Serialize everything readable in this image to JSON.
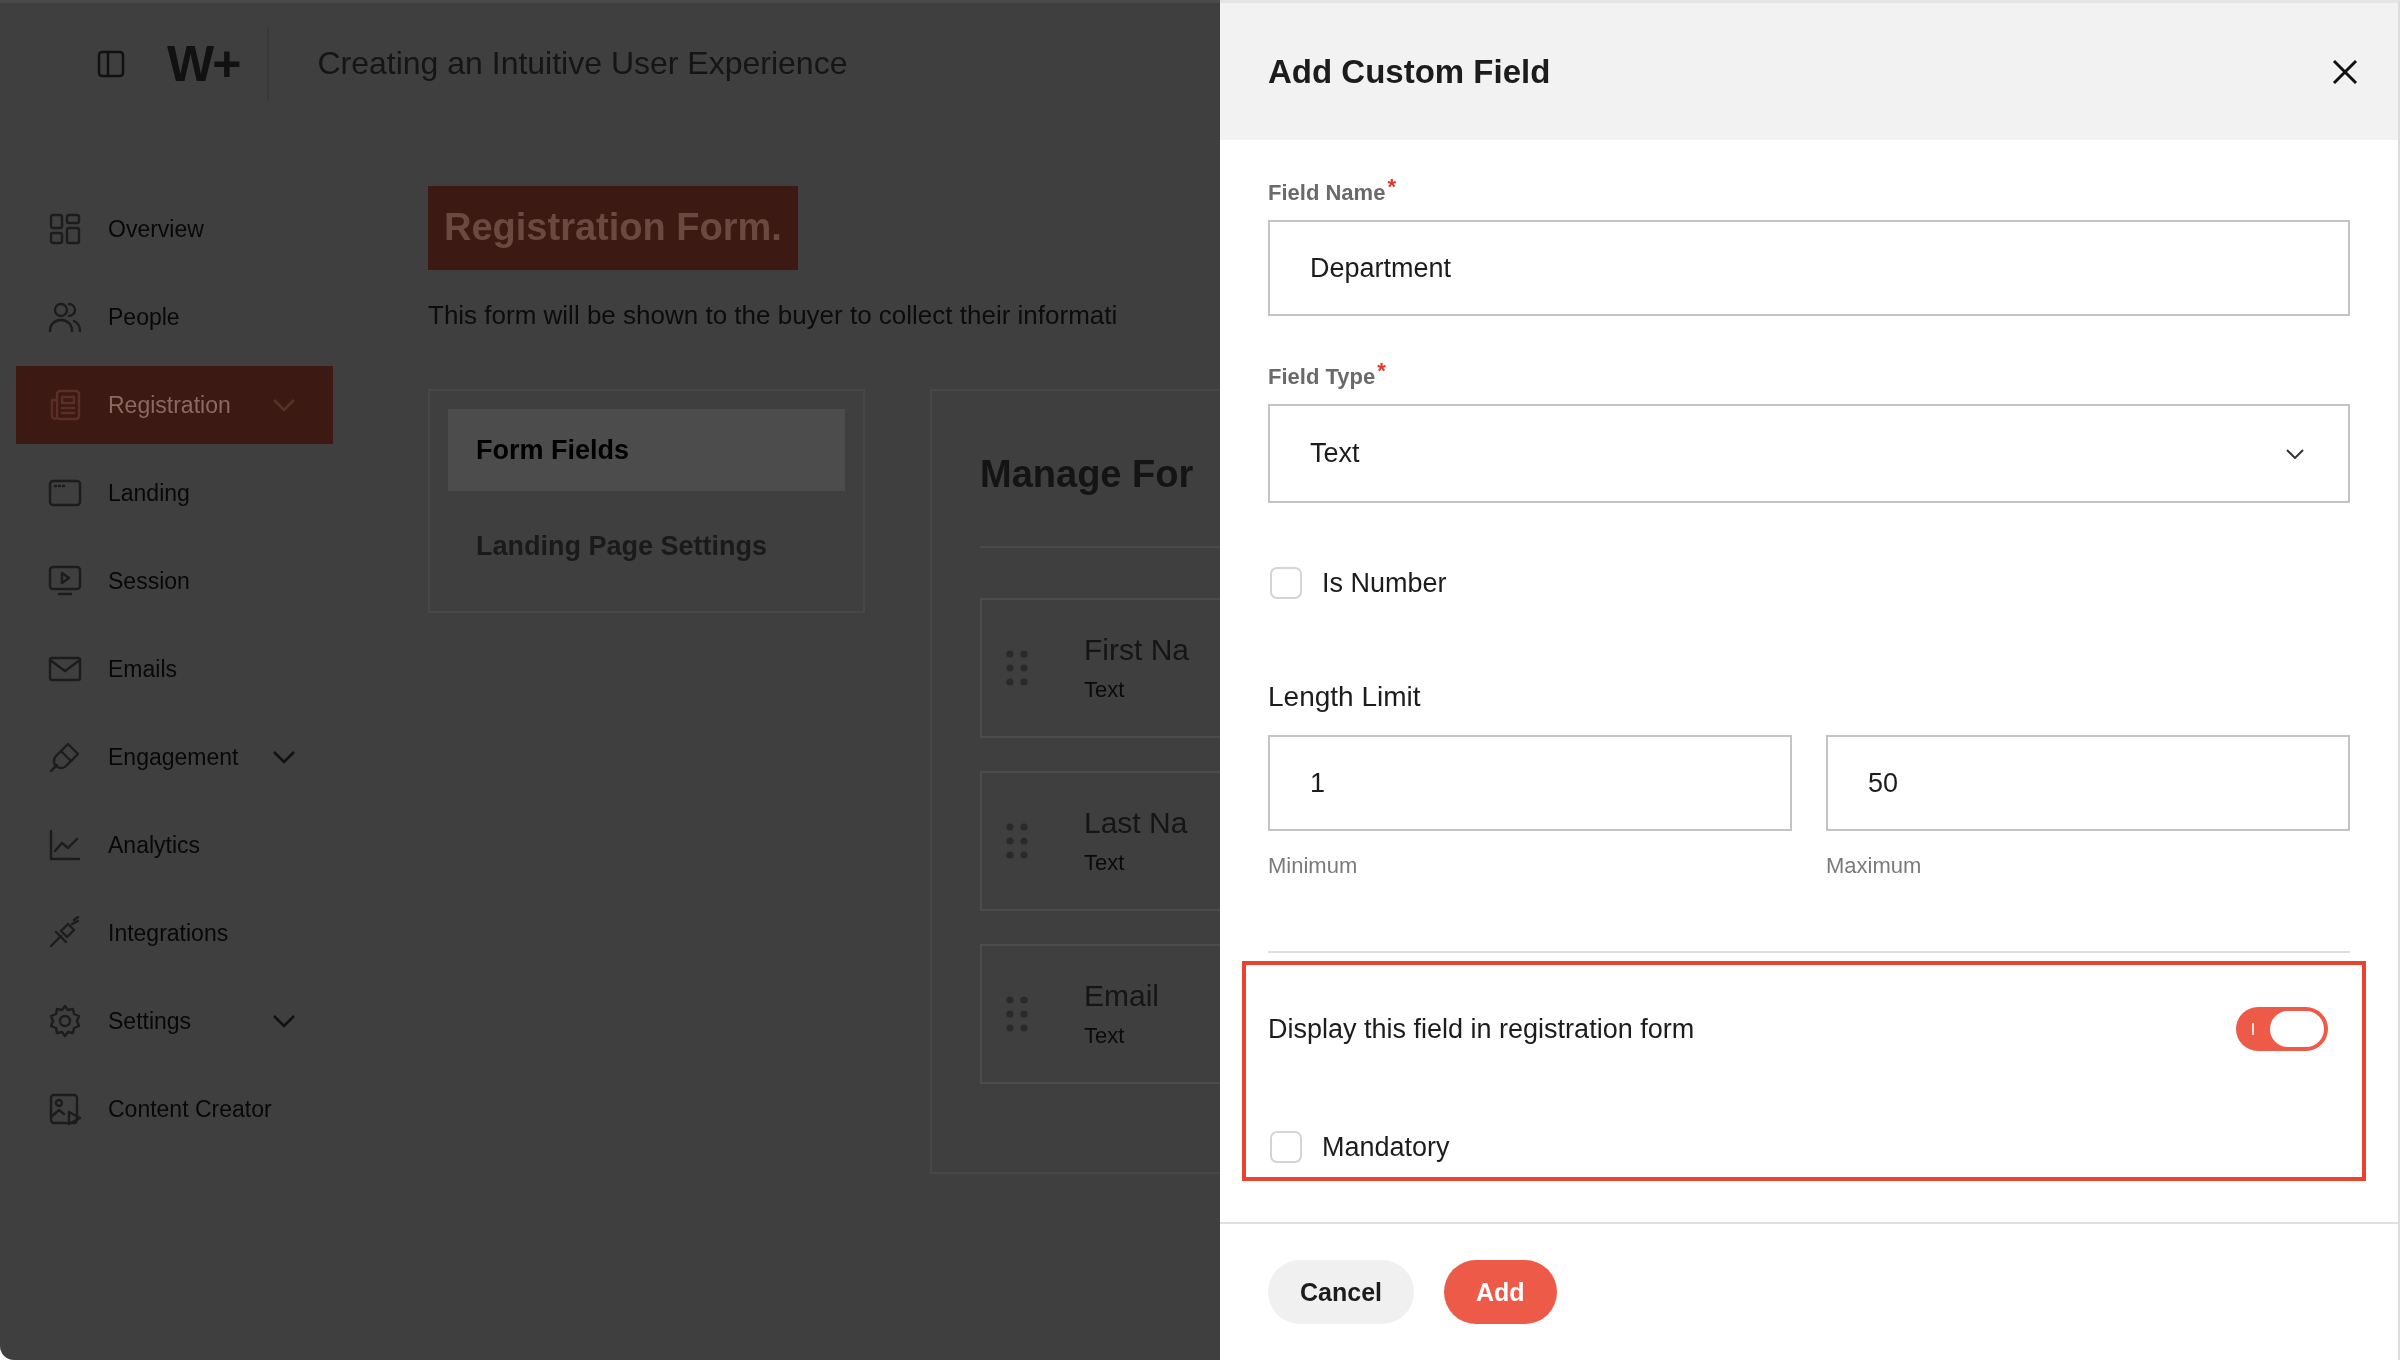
{
  "app_header": {
    "logo": "W+",
    "title": "Creating an Intuitive User Experience"
  },
  "sidebar": {
    "items": [
      {
        "label": "Overview",
        "selected": false,
        "expandable": false
      },
      {
        "label": "People",
        "selected": false,
        "expandable": false
      },
      {
        "label": "Registration",
        "selected": true,
        "expandable": true
      },
      {
        "label": "Landing",
        "selected": false,
        "expandable": false
      },
      {
        "label": "Session",
        "selected": false,
        "expandable": false
      },
      {
        "label": "Emails",
        "selected": false,
        "expandable": false
      },
      {
        "label": "Engagement",
        "selected": false,
        "expandable": true
      },
      {
        "label": "Analytics",
        "selected": false,
        "expandable": false
      },
      {
        "label": "Integrations",
        "selected": false,
        "expandable": false
      },
      {
        "label": "Settings",
        "selected": false,
        "expandable": true
      },
      {
        "label": "Content Creator",
        "selected": false,
        "expandable": false
      }
    ]
  },
  "page": {
    "title": "Registration Form.",
    "description": "This form will be shown to the buyer to collect their informati",
    "tabs": [
      {
        "label": "Form Fields",
        "selected": true
      },
      {
        "label": "Landing Page Settings",
        "selected": false
      }
    ],
    "manage": {
      "title": "Manage For",
      "fields": [
        {
          "name": "First Na",
          "type": "Text"
        },
        {
          "name": "Last Na",
          "type": "Text"
        },
        {
          "name": "Email",
          "type": "Text"
        }
      ]
    }
  },
  "dialog": {
    "title": "Add Custom Field",
    "field_name": {
      "label": "Field Name",
      "marker": "*",
      "value": "Department"
    },
    "field_type": {
      "label": "Field Type",
      "marker": "*",
      "value": "Text"
    },
    "is_number": {
      "label": "Is Number",
      "checked": false
    },
    "length_limit": {
      "label": "Length Limit",
      "minimum": {
        "value": "1",
        "caption": "Minimum"
      },
      "maximum": {
        "value": "50",
        "caption": "Maximum"
      }
    },
    "display_in_form": {
      "label": "Display this field in registration form",
      "on": true
    },
    "mandatory": {
      "label": "Mandatory",
      "checked": false
    },
    "buttons": [
      {
        "label": "Cancel",
        "kind": "secondary"
      },
      {
        "label": "Add",
        "kind": "primary"
      }
    ]
  }
}
